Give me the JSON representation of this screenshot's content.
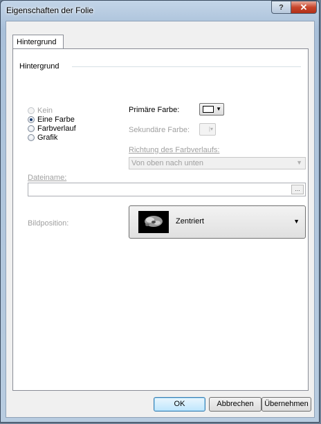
{
  "window": {
    "title": "Eigenschaften der Folie",
    "help_label": "?",
    "close_label": "✕"
  },
  "tab": {
    "label": "Hintergrund"
  },
  "group": {
    "title": "Hintergrund"
  },
  "fill_options": [
    {
      "label": "Kein",
      "checked": false,
      "enabled": false
    },
    {
      "label": "Eine Farbe",
      "checked": true,
      "enabled": true
    },
    {
      "label": "Farbverlauf",
      "checked": false,
      "enabled": true
    },
    {
      "label": "Grafik",
      "checked": false,
      "enabled": true
    }
  ],
  "primary_color": {
    "label": "Primäre Farbe:",
    "value": "#ffffff"
  },
  "secondary_color": {
    "label": "Sekundäre Farbe:"
  },
  "gradient_direction": {
    "label": "Richtung des Farbverlaufs:",
    "value": "Von oben nach unten"
  },
  "filename": {
    "label": "Dateiname:",
    "value": "",
    "browse_label": "..."
  },
  "image_position": {
    "label": "Bildposition:",
    "value": "Zentriert"
  },
  "buttons": {
    "ok": "OK",
    "cancel": "Abbrechen",
    "apply": "Übernehmen"
  }
}
